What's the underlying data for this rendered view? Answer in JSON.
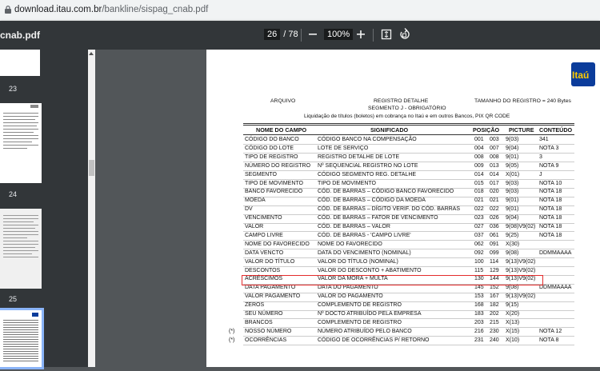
{
  "browser": {
    "url_domain": "download.itau.com.br",
    "url_path": "/bankline/sispag_cnab.pdf"
  },
  "toolbar": {
    "filename": "cnab.pdf",
    "page_current": "26",
    "page_total": "/ 78",
    "zoom": "100%"
  },
  "sidebar": {
    "thumbs": [
      {
        "label": "23"
      },
      {
        "label": "24"
      },
      {
        "label": "25"
      }
    ]
  },
  "doc": {
    "logo": "Itaú",
    "header": {
      "arquivo": "ARQUIVO",
      "registro": "REGISTRO DETALHE",
      "segmento": "SEGMENTO J - OBRIGATÓRIO",
      "tamanho": "TAMANHO DO REGISTRO = 240 Bytes",
      "liquidacao": "Liquidação de títulos (boletos) em cobrança no Itaú e em outros Bancos, PIX QR CODE"
    },
    "cols": {
      "nome": "NOME DO CAMPO",
      "significado": "SIGNIFICADO",
      "posicao": "POSIÇÃO",
      "picture": "PICTURE",
      "conteudo": "CONTEÚDO"
    },
    "rows": [
      {
        "m": "",
        "n": "CÓDIGO DO BANCO",
        "s": "CÓDIGO BANCO NA COMPENSAÇÃO",
        "p1": "001",
        "p2": "003",
        "pic": "9(03)",
        "c": "341"
      },
      {
        "m": "",
        "n": "CÓDIGO DO LOTE",
        "s": "LOTE DE SERVIÇO",
        "p1": "004",
        "p2": "007",
        "pic": "9(04)",
        "c": "NOTA 3"
      },
      {
        "m": "",
        "n": "TIPO DE REGISTRO",
        "s": "REGISTRO DETALHE DE LOTE",
        "p1": "008",
        "p2": "008",
        "pic": "9(01)",
        "c": "3"
      },
      {
        "m": "",
        "n": "NÚMERO DO REGISTRO",
        "s": "Nº SEQUENCIAL REGISTRO NO LOTE",
        "p1": "009",
        "p2": "013",
        "pic": "9(05)",
        "c": "NOTA 9"
      },
      {
        "m": "",
        "n": "SEGMENTO",
        "s": "CÓDIGO SEGMENTO REG. DETALHE",
        "p1": "014",
        "p2": "014",
        "pic": "X(01)",
        "c": "J"
      },
      {
        "m": "",
        "n": "TIPO DE MOVIMENTO",
        "s": "TIPO DE MOVIMENTO",
        "p1": "015",
        "p2": "017",
        "pic": "9(03)",
        "c": "NOTA 10"
      },
      {
        "m": "",
        "n": "BANCO FAVORECIDO",
        "s": "CÓD. DE BARRAS – CÓDIGO BANCO FAVORECIDO",
        "p1": "018",
        "p2": "020",
        "pic": "9(03)",
        "c": "NOTA 18"
      },
      {
        "m": "",
        "n": "MOEDA",
        "s": "CÓD. DE BARRAS – CÓDIGO DA MOEDA",
        "p1": "021",
        "p2": "021",
        "pic": "9(01)",
        "c": "NOTA 18"
      },
      {
        "m": "",
        "n": "DV",
        "s": "CÓD. DE BARRAS – DÍGITO VERIF. DO CÓD. BARRAS",
        "p1": "022",
        "p2": "022",
        "pic": "9(01)",
        "c": "NOTA 18"
      },
      {
        "m": "",
        "n": "VENCIMENTO",
        "s": "CÓD. DE BARRAS – FATOR DE VENCIMENTO",
        "p1": "023",
        "p2": "026",
        "pic": "9(04)",
        "c": "NOTA 18"
      },
      {
        "m": "",
        "n": "VALOR",
        "s": "CÓD. DE BARRAS – VALOR",
        "p1": "027",
        "p2": "036",
        "pic": "9(08)V9(02)",
        "c": "NOTA 18"
      },
      {
        "m": "",
        "n": "CAMPO LIVRE",
        "s": "CÓD. DE BARRAS - 'CAMPO LIVRE'",
        "p1": "037",
        "p2": "061",
        "pic": "9(25)",
        "c": "NOTA 18"
      },
      {
        "m": "",
        "n": "NOME DO FAVORECIDO",
        "s": "NOME DO FAVORECIDO",
        "p1": "062",
        "p2": "091",
        "pic": "X(30)",
        "c": ""
      },
      {
        "m": "",
        "n": "DATA VENCTO",
        "s": "DATA DO VENCIMENTO (NOMINAL)",
        "p1": "092",
        "p2": "099",
        "pic": "9(08)",
        "c": "DDMMAAAA"
      },
      {
        "m": "",
        "n": "VALOR DO TÍTULO",
        "s": "VALOR DO TÍTULO (NOMINAL)",
        "p1": "100",
        "p2": "114",
        "pic": "9(13)V9(02)",
        "c": ""
      },
      {
        "m": "",
        "n": "DESCONTOS",
        "s": "VALOR DO DESCONTO + ABATIMENTO",
        "p1": "115",
        "p2": "129",
        "pic": "9(13)V9(02)",
        "c": ""
      },
      {
        "m": "",
        "n": "ACRÉSCIMOS",
        "s": "VALOR DA MORA + MULTA",
        "p1": "130",
        "p2": "144",
        "pic": "9(13)V9(02)",
        "c": ""
      },
      {
        "m": "",
        "n": "DATA PAGAMENTO",
        "s": "DATA DO PAGAMENTO",
        "p1": "145",
        "p2": "152",
        "pic": "9(08)",
        "c": "DDMMAAAA"
      },
      {
        "m": "",
        "n": "VALOR PAGAMENTO",
        "s": "VALOR DO PAGAMENTO",
        "p1": "153",
        "p2": "167",
        "pic": "9(13)V9(02)",
        "c": ""
      },
      {
        "m": "",
        "n": "ZEROS",
        "s": "COMPLEMENTO DE REGISTRO",
        "p1": "168",
        "p2": "182",
        "pic": "9(15)",
        "c": ""
      },
      {
        "m": "",
        "n": "SEU NÚMERO",
        "s": "Nº DOCTO ATRIBUÍDO PELA EMPRESA",
        "p1": "183",
        "p2": "202",
        "pic": "X(20)",
        "c": ""
      },
      {
        "m": "",
        "n": "BRANCOS",
        "s": "COMPLEMENTO DE REGISTRO",
        "p1": "203",
        "p2": "215",
        "pic": "X(13)",
        "c": ""
      },
      {
        "m": "(*)",
        "n": "NOSSO NÚMERO",
        "s": "NÚMERO ATRIBUÍDO PELO BANCO",
        "p1": "216",
        "p2": "230",
        "pic": "X(15)",
        "c": "NOTA 12"
      },
      {
        "m": "(*)",
        "n": "OCORRÊNCIAS",
        "s": "CÓDIGO DE OCORRÊNCIAS P/ RETORNO",
        "p1": "231",
        "p2": "240",
        "pic": "X(10)",
        "c": "NOTA 8"
      }
    ]
  },
  "colors": {
    "toolbar": "#323639",
    "viewer_bg": "#525659",
    "highlight": "#e32c2c",
    "itau_blue": "#0b3c9b",
    "itau_yellow": "#ffcc00"
  }
}
